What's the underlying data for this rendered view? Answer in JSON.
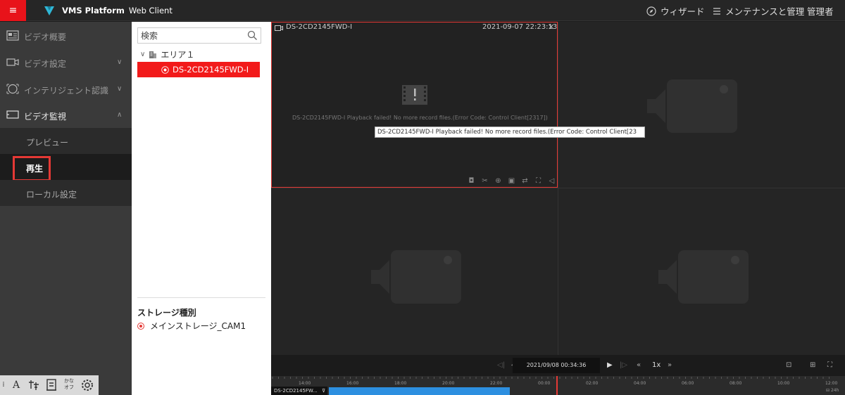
{
  "app": {
    "title": "VMS Platform",
    "subtitle": "Web Client"
  },
  "topbar": {
    "menu_glyph": "≡",
    "wizard": "ウィザード",
    "maintenance": "メンテナンスと管理",
    "user": "管理者"
  },
  "nav": {
    "items": [
      {
        "label": "ビデオ概要"
      },
      {
        "label": "ビデオ設定"
      },
      {
        "label": "インテリジェント認識"
      },
      {
        "label": "ビデオ監視"
      }
    ],
    "sub": [
      {
        "label": "プレビュー"
      },
      {
        "label": "再生"
      },
      {
        "label": "ローカル設定"
      }
    ],
    "tools": {
      "kana": "かな\nオフ"
    }
  },
  "tree": {
    "search_placeholder": "検索",
    "area": "エリア１",
    "camera": "DS-2CD2145FWD-I",
    "storage_title": "ストレージ種別",
    "storage_option": "メインストレージ_CAM1"
  },
  "player": {
    "camera": "DS-2CD2145FWD-I",
    "timestamp": "2021-09-07 22:23:13",
    "error": "DS-2CD2145FWD-I Playback failed! No more record files.(Error Code: Control Client[2317])",
    "tooltip": "DS-2CD2145FWD-I Playback failed! No more record files.(Error Code: Control Client[23"
  },
  "controls": {
    "time": "2021/09/08 00:34:36",
    "speed": "1x"
  },
  "timeline": {
    "camera": "DS-2CD2145FW...",
    "labels": [
      "14:00",
      "16:00",
      "18:00",
      "20:00",
      "22:00",
      "00:00",
      "02:00",
      "04:00",
      "06:00",
      "08:00",
      "10:00",
      "12:00"
    ],
    "mode": "24h"
  },
  "colors": {
    "accent": "#e8131a",
    "recording": "#2d8fe0"
  }
}
